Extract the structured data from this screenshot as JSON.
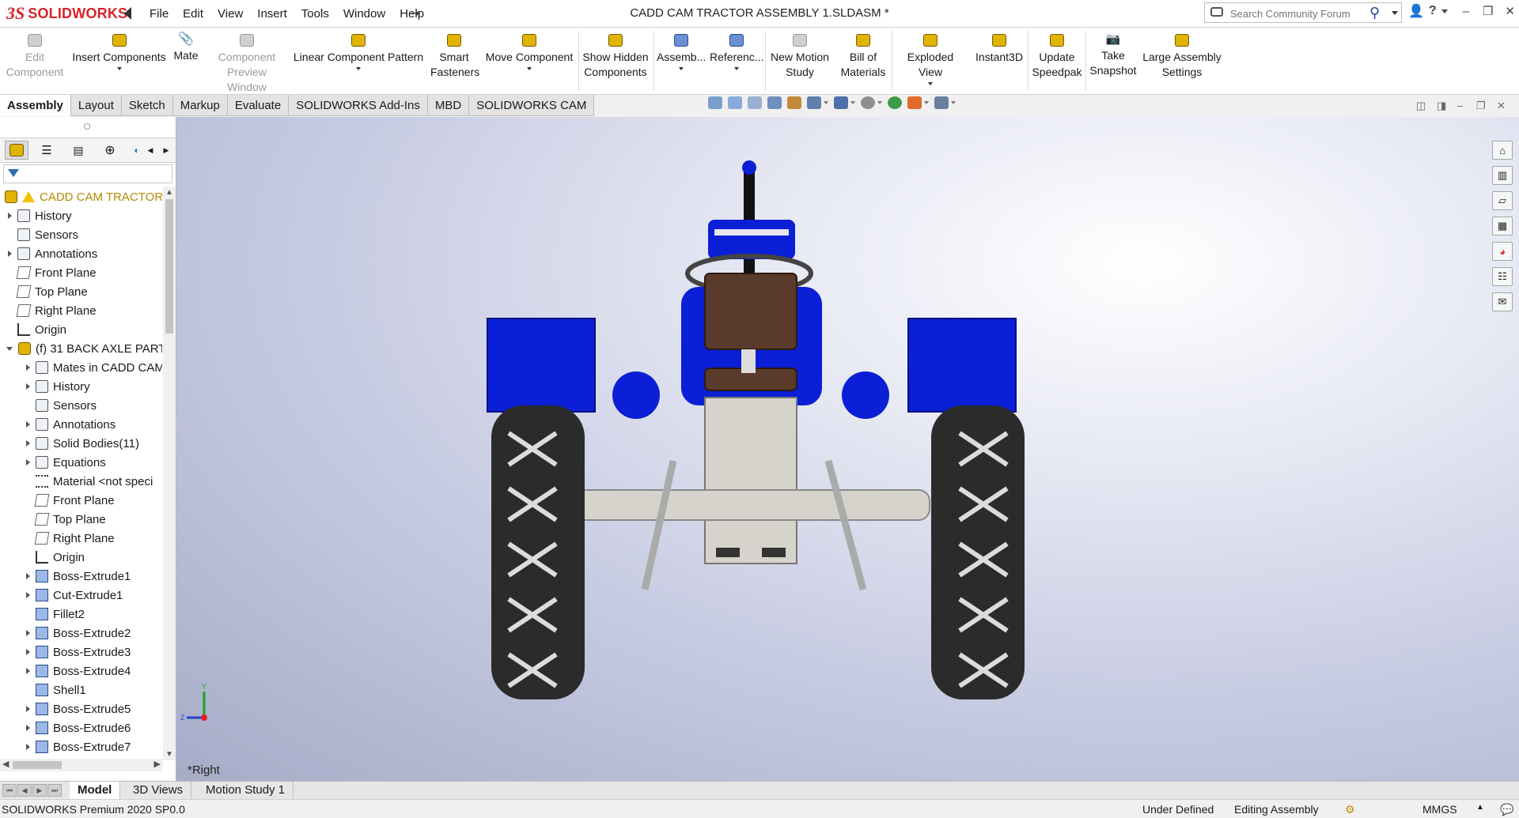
{
  "app": {
    "logo_mark": "3S",
    "logo_solid": "SOLID",
    "logo_works": "WORKS",
    "document_title": "CADD CAM TRACTOR ASSEMBLY 1.SLDASM *"
  },
  "menu": [
    "File",
    "Edit",
    "View",
    "Insert",
    "Tools",
    "Window",
    "Help"
  ],
  "search": {
    "placeholder": "Search Community Forum"
  },
  "commands": {
    "edit_component": [
      "Edit",
      "Component"
    ],
    "insert_components": "Insert Components",
    "mate": "Mate",
    "component_preview": [
      "Component",
      "Preview Window"
    ],
    "linear_pattern": "Linear Component Pattern",
    "smart_fasteners": [
      "Smart",
      "Fasteners"
    ],
    "move_component": "Move Component",
    "show_hidden": [
      "Show Hidden",
      "Components"
    ],
    "assembly": "Assemb...",
    "reference": "Referenc...",
    "new_motion": [
      "New Motion",
      "Study"
    ],
    "bill_of_materials": [
      "Bill of",
      "Materials"
    ],
    "exploded_view": "Exploded View",
    "instant3d": "Instant3D",
    "update_speedpak": [
      "Update",
      "Speedpak"
    ],
    "take_snapshot": [
      "Take",
      "Snapshot"
    ],
    "large_assembly": [
      "Large Assembly",
      "Settings"
    ]
  },
  "tabs": [
    "Assembly",
    "Layout",
    "Sketch",
    "Markup",
    "Evaluate",
    "SOLIDWORKS Add-Ins",
    "MBD",
    "SOLIDWORKS CAM"
  ],
  "tree": {
    "root": "CADD CAM TRACTOR ...",
    "top_items": [
      "History",
      "Sensors",
      "Annotations",
      "Front Plane",
      "Top Plane",
      "Right Plane",
      "Origin"
    ],
    "part": "(f) 31 BACK AXLE PART",
    "part_items": [
      "Mates in CADD CAM",
      "History",
      "Sensors",
      "Annotations",
      "Solid Bodies(11)",
      "Equations",
      "Material <not speci",
      "Front Plane",
      "Top Plane",
      "Right Plane",
      "Origin",
      "Boss-Extrude1",
      "Cut-Extrude1",
      "Fillet2",
      "Boss-Extrude2",
      "Boss-Extrude3",
      "Boss-Extrude4",
      "Shell1",
      "Boss-Extrude5",
      "Boss-Extrude6",
      "Boss-Extrude7"
    ]
  },
  "viewport": {
    "view_label": "*Right",
    "axis_y": "Y",
    "axis_z": "Z",
    "colors": {
      "tractor_blue": "#0a1fd6",
      "tire": "#2b2b2b",
      "metal": "#d6d3cc",
      "seat": "#5a3a2a"
    }
  },
  "bottom_tabs": [
    "Model",
    "3D Views",
    "Motion Study 1"
  ],
  "status": {
    "product": "SOLIDWORKS Premium 2020 SP0.0",
    "definition": "Under Defined",
    "mode": "Editing Assembly",
    "units": "MMGS"
  }
}
